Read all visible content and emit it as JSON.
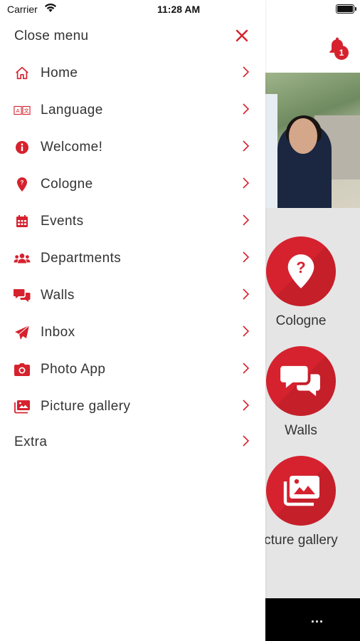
{
  "status_bar": {
    "carrier": "Carrier",
    "time": "11:28 AM"
  },
  "drawer": {
    "close_label": "Close menu",
    "items": [
      {
        "label": "Home",
        "icon": "home-icon"
      },
      {
        "label": "Language",
        "icon": "language-icon"
      },
      {
        "label": "Welcome!",
        "icon": "info-icon"
      },
      {
        "label": "Cologne",
        "icon": "map-pin-icon"
      },
      {
        "label": "Events",
        "icon": "calendar-icon"
      },
      {
        "label": "Departments",
        "icon": "users-icon"
      },
      {
        "label": "Walls",
        "icon": "chat-icon"
      },
      {
        "label": "Inbox",
        "icon": "paper-plane-icon"
      },
      {
        "label": "Photo App",
        "icon": "camera-icon"
      },
      {
        "label": "Picture gallery",
        "icon": "gallery-icon"
      },
      {
        "label": "Extra",
        "icon": ""
      }
    ]
  },
  "background": {
    "notification_count": "1",
    "tiles": [
      {
        "label": "Cologne",
        "icon": "map-question-icon"
      },
      {
        "label": "Walls",
        "icon": "chat-bubbles-icon"
      },
      {
        "label": "cture gallery",
        "icon": "gallery-icon"
      }
    ],
    "more_label": "..."
  },
  "colors": {
    "accent": "#d6222e",
    "drawer_bg": "#ffffff",
    "background": "#e5e5e5",
    "text": "#333333"
  }
}
